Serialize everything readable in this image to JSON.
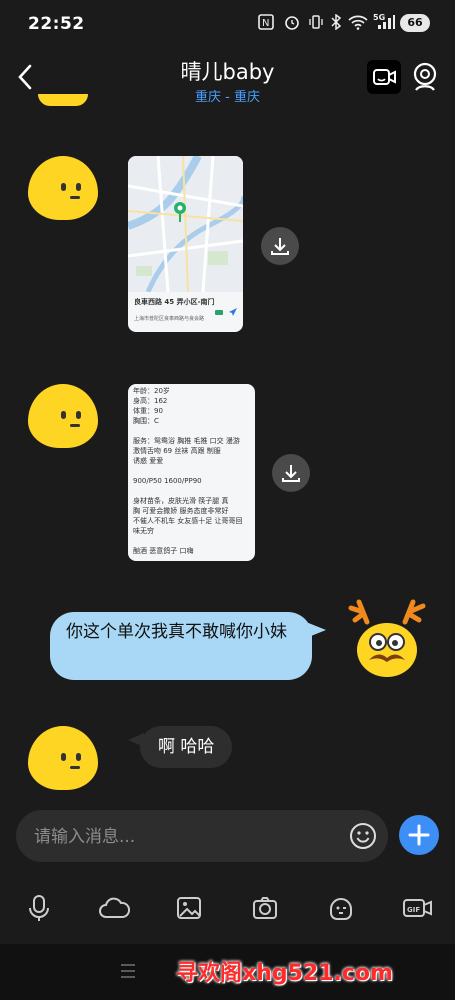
{
  "status_bar": {
    "time": "22:52",
    "network": "5G",
    "battery": "66",
    "icons": [
      "nfc-icon",
      "alarm-icon",
      "vibrate-icon",
      "bluetooth-icon",
      "wifi-icon",
      "signal-icon",
      "battery-icon"
    ]
  },
  "header": {
    "title": "晴儿baby",
    "subtitle": "重庆 - 重庆",
    "subtitle_color": "#4a9fff"
  },
  "messages": {
    "location_card": {
      "place": "良車西路 45 弄小区-南门",
      "address": "上海市普陀区良車西路与良会路",
      "small_labels": [
        "宝山新村",
        "祁连山"
      ]
    },
    "profile_card": {
      "lines": [
        "年龄：20岁",
        "身高：162",
        "体重：90",
        "胸围：C",
        "",
        "服务：鸳鸯浴 胸推 毛推 口交 漫游",
        "激情舌吻 69 丝袜 高跟 制服",
        "诱惑 爱爱",
        "",
        "900/P50   1600/PP90",
        "",
        "身材苗条，皮肤光滑 筷子腿 真",
        "胸 可爱会撒娇 服务态度非常好",
        "不催人不机车 女友感十足 让哥哥回",
        "味无穷",
        "",
        "酗酒  恶意鸽子 口嗨"
      ]
    },
    "outgoing_text": "你这个单次我真不敢喊你小妹",
    "incoming_text": "啊 哈哈"
  },
  "input": {
    "placeholder": "请输入消息..."
  },
  "toolbar": {
    "icons": [
      "microphone-icon",
      "cloud-icon",
      "image-icon",
      "camera-icon",
      "sticker-icon",
      "gif-icon"
    ]
  },
  "watermark": "寻欢阁xhg521.com",
  "colors": {
    "background": "#1b1b1b",
    "outgoing_bubble": "#a8d8f6",
    "incoming_bubble": "#2e2e2e",
    "avatar_yellow": "#ffd523",
    "accent_blue": "#3d8ff5"
  }
}
